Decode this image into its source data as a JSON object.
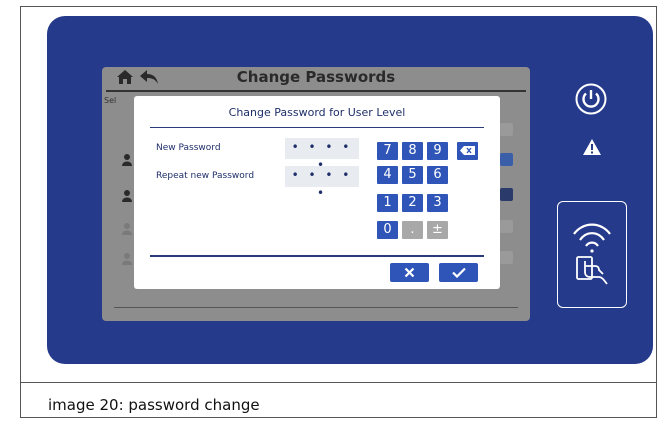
{
  "screen": {
    "title": "Change Passwords",
    "select_text": "Sel"
  },
  "dialog": {
    "title": "Change Password for User Level",
    "new_password_label": "New Password",
    "new_password_value": "• • • • •",
    "repeat_password_label": "Repeat new Password",
    "repeat_password_value": "• • • • •"
  },
  "keypad": {
    "keys": [
      "7",
      "8",
      "9",
      "4",
      "5",
      "6",
      "1",
      "2",
      "3",
      "0",
      ".",
      "±"
    ]
  },
  "caption": "image 20: password change",
  "colors": {
    "device_blue": "#253a8a",
    "key_blue": "#2e55b7",
    "screen_gray": "#8d8d8d"
  },
  "icons": [
    "home-icon",
    "back-icon",
    "backspace-icon",
    "cancel-icon",
    "confirm-icon",
    "power-icon",
    "warning-icon",
    "nfc-card-icon",
    "user-icon",
    "edit-icon"
  ]
}
